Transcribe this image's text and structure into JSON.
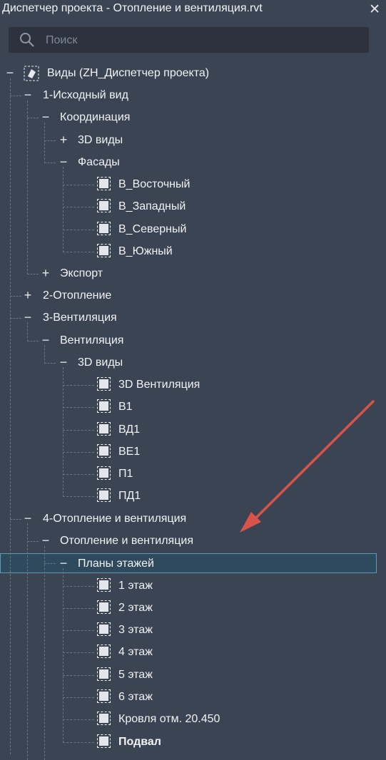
{
  "window": {
    "title": "Диспетчер проекта - Отопление и вентиляция.rvt",
    "close_icon": "close-icon"
  },
  "search": {
    "placeholder": "Поиск",
    "value": ""
  },
  "tree": {
    "root": "Виды (ZH_Диспетчер проекта)",
    "n1": "1-Исходный вид",
    "n1_coord": "Координация",
    "n1_coord_3d": "3D виды",
    "n1_coord_facades": "Фасады",
    "f1": "В_Восточный",
    "f2": "В_Западный",
    "f3": "В_Северный",
    "f4": "В_Южный",
    "n1_export": "Экспорт",
    "n2": "2-Отопление",
    "n3": "3-Вентиляция",
    "n3_vent": "Вентиляция",
    "n3_vent_3d": "3D виды",
    "v1": "3D Вентиляция",
    "v2": "В1",
    "v3": "ВД1",
    "v4": "ВЕ1",
    "v5": "П1",
    "v6": "ПД1",
    "n4": "4-Отопление и вентиляция",
    "n4_hv": "Отопление и вентиляция",
    "n4_plans": "Планы этажей",
    "p1": "1 этаж",
    "p2": "2 этаж",
    "p3": "3 этаж",
    "p4": "4 этаж",
    "p5": "5 этаж",
    "p6": "6 этаж",
    "p7": "Кровля отм. 20.450",
    "p8": "Подвал"
  },
  "colors": {
    "background": "#3b4453",
    "selection": "#2f4a5c",
    "selection_border": "#5e9ab8",
    "arrow": "#d9534a"
  }
}
